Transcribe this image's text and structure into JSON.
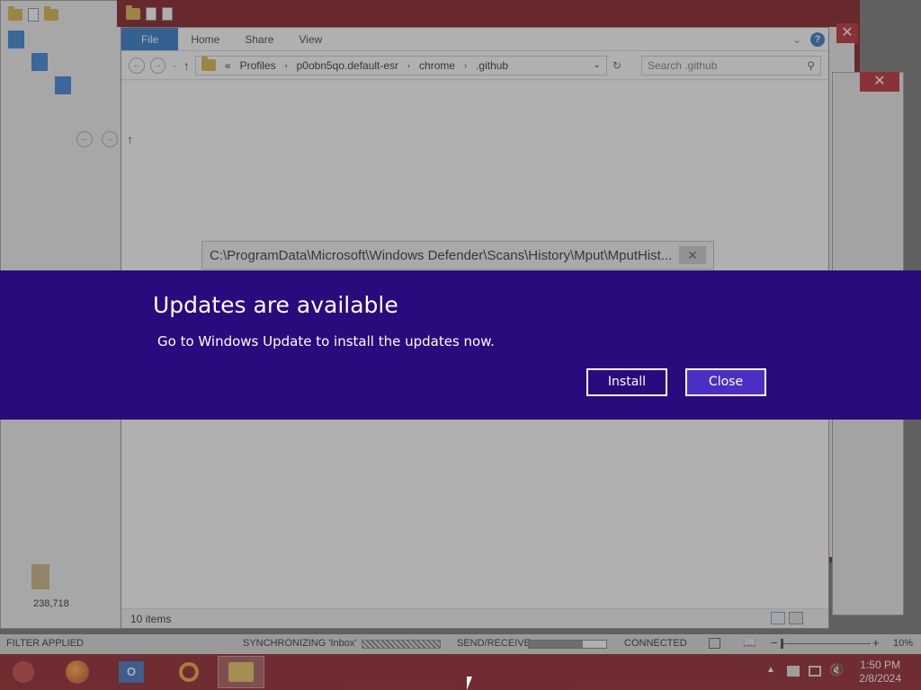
{
  "explorer": {
    "ribbon_tabs": [
      "File",
      "Home",
      "Share",
      "View"
    ],
    "address_prefix": "«",
    "breadcrumbs": [
      "Profiles",
      "p0obn5qo.default-esr",
      "chrome",
      ".github"
    ],
    "search_placeholder": "Search .github",
    "item_count": "10 items"
  },
  "path_tooltip": {
    "text": "C:\\ProgramData\\Microsoft\\Windows Defender\\Scans\\History\\Mput\\MputHist..."
  },
  "left_panel": {
    "number": "238,718"
  },
  "outlook_status": {
    "filter": "FILTER APPLIED",
    "sync": "SYNCHRONIZING  'Inbox'",
    "send_receive": "SEND/RECEIVE",
    "send_receive_progress": 0.7,
    "connection": "CONNECTED",
    "zoom": "10%"
  },
  "dialog": {
    "title": "Updates are available",
    "message": "Go to Windows Update to install the updates now.",
    "install_label": "Install",
    "close_label": "Close"
  },
  "taskbar": {
    "time": "1:50 PM",
    "date": "2/8/2024"
  },
  "colors": {
    "dialog_bg": "#2a0a7c",
    "close_button_bg": "#4b2ec4",
    "taskbar_bg": "#8a1218",
    "window_accent": "#7d0a12",
    "ribbon_file": "#1f6fc5"
  }
}
